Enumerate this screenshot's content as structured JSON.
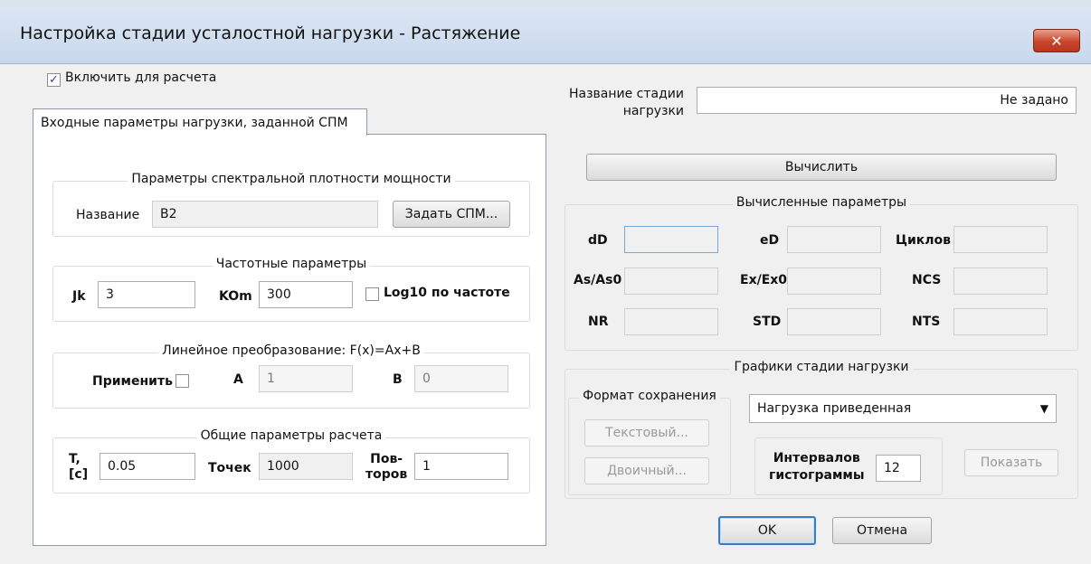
{
  "window": {
    "title": "Настройка стадии усталостной нагрузки - Растяжение",
    "close_glyph": "✕"
  },
  "include": {
    "label": "Включить для расчета",
    "checked": true,
    "check_glyph": "✓"
  },
  "tab": {
    "label": "Входные параметры нагрузки, заданной СПМ"
  },
  "spm": {
    "legend": "Параметры спектральной плотности мощности",
    "name_label": "Название",
    "name_value": "B2",
    "set_button": "Задать СПМ..."
  },
  "freq": {
    "legend": "Частотные параметры",
    "jk_label": "Jk",
    "jk_value": "3",
    "kom_label": "KOm",
    "kom_value": "300",
    "log_label": "Log10 по частоте",
    "log_checked": false
  },
  "linear": {
    "legend": "Линейное преобразование: F(x)=Ax+B",
    "apply_label": "Применить",
    "apply_checked": false,
    "a_label": "A",
    "a_value": "1",
    "b_label": "B",
    "b_value": "0"
  },
  "general": {
    "legend": "Общие параметры расчета",
    "t_label_line1": "T,",
    "t_label_line2": "[c]",
    "t_value": "0.05",
    "points_label": "Точек",
    "points_value": "1000",
    "repeats_label_line1": "Пов-",
    "repeats_label_line2": "торов",
    "repeats_value": "1"
  },
  "stage_name": {
    "label_line1": "Название стадии",
    "label_line2": "нагрузки",
    "value": "Не задано"
  },
  "compute_button": "Вычислить",
  "computed": {
    "legend": "Вычисленные параметры",
    "dD": {
      "label": "dD",
      "value": ""
    },
    "eD": {
      "label": "eD",
      "value": ""
    },
    "cycles": {
      "label": "Циклов",
      "value": ""
    },
    "AsAs0": {
      "label": "As/As0",
      "value": ""
    },
    "ExEx0": {
      "label": "Ex/Ex0",
      "value": ""
    },
    "NCS": {
      "label": "NCS",
      "value": ""
    },
    "NR": {
      "label": "NR",
      "value": ""
    },
    "STD": {
      "label": "STD",
      "value": ""
    },
    "NTS": {
      "label": "NTS",
      "value": ""
    }
  },
  "graphs": {
    "legend": "Графики стадии нагрузки",
    "format_legend": "Формат сохранения",
    "text_button": "Текстовый...",
    "binary_button": "Двоичный...",
    "graph_select_value": "Нагрузка приведенная",
    "hist_label_line1": "Интервалов",
    "hist_label_line2": "гистограммы",
    "hist_value": "12",
    "show_button": "Показать"
  },
  "footer": {
    "ok": "OK",
    "cancel": "Отмена"
  }
}
